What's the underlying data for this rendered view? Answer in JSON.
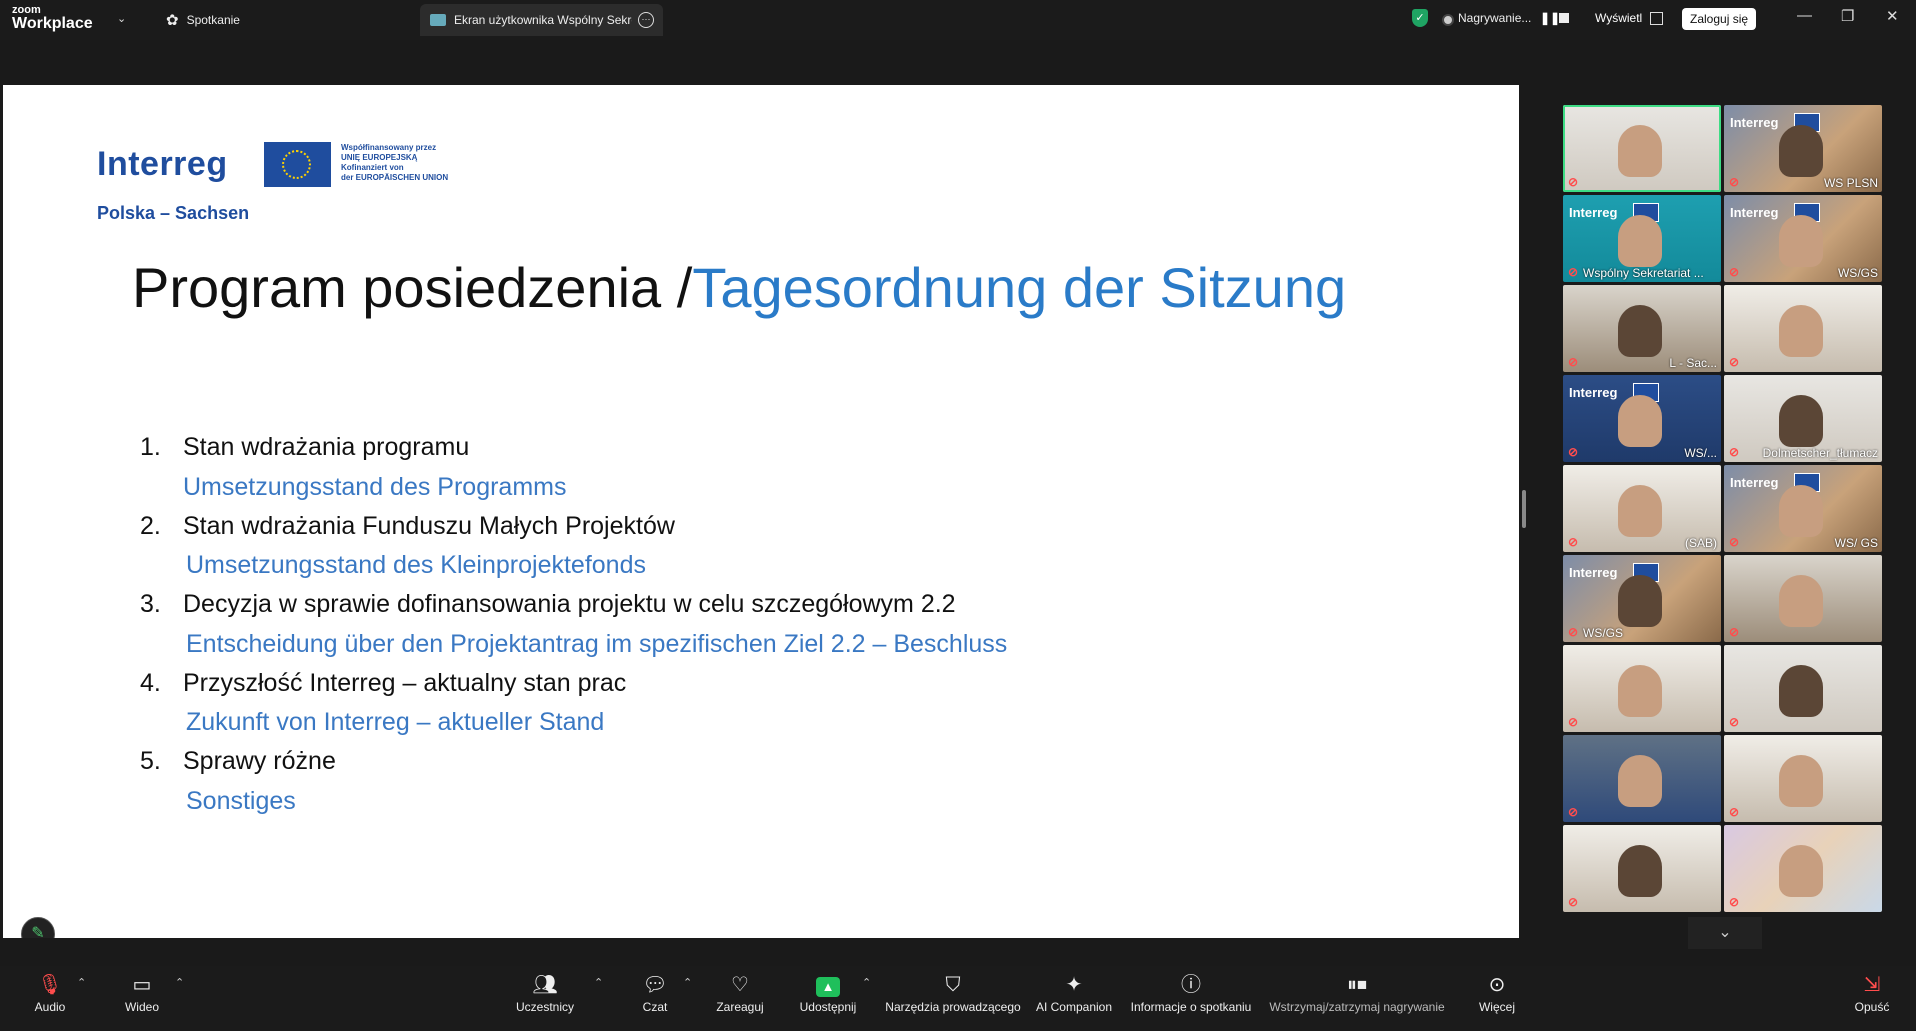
{
  "topbar": {
    "brand_line1": "zoom",
    "brand_line2": "Workplace",
    "meeting_tab": "Spotkanie",
    "share_tab": "Ekran użytkownika Wspólny Sekretariat",
    "recording_label": "Nagrywanie...",
    "view_label": "Wyświetl",
    "login_button": "Zaloguj się"
  },
  "slide": {
    "logo_word": "Interreg",
    "eu_text": [
      "Współfinansowany przez",
      "UNIĘ EUROPEJSKĄ",
      "Kofinanziert von",
      "der EUROPÄISCHEN UNION"
    ],
    "logo_sub": "Polska – Sachsen",
    "title_pl": "Program posiedzenia /",
    "title_de": "Tagesordnung der Sitzung",
    "agenda": [
      {
        "num": "1.",
        "pl": "Stan wdrażania programu",
        "de": "Umsetzungsstand des Programms"
      },
      {
        "num": "2.",
        "pl": "Stan wdrażania Funduszu Małych Projektów",
        "de": "Umsetzungsstand des Kleinprojektefonds"
      },
      {
        "num": "3.",
        "pl": "Decyzja w sprawie dofinansowania projektu w celu szczegółowym 2.2",
        "de": "Entscheidung über den Projektantrag im spezifischen Ziel 2.2 – Beschluss"
      },
      {
        "num": "4.",
        "pl": "Przyszłość Interreg – aktualny stan prac",
        "de": "Zukunft von Interreg – aktueller Stand"
      },
      {
        "num": "5.",
        "pl": "Sprawy różne",
        "de": "Sonstiges"
      }
    ]
  },
  "gallery": {
    "tiles": [
      {
        "name": "",
        "style": "person",
        "active": true
      },
      {
        "name": "WS PLSN",
        "style": "interreg-city"
      },
      {
        "name": "Wspólny Sekretariat ...",
        "style": "interreg-teal"
      },
      {
        "name": "WS/GS",
        "style": "interreg-city"
      },
      {
        "name": "L - Sac...",
        "style": "office"
      },
      {
        "name": "",
        "style": "room"
      },
      {
        "name": "WS/...",
        "style": "interreg-navy"
      },
      {
        "name": "Dolmetscher_tłumacz",
        "style": "person"
      },
      {
        "name": "(SAB)",
        "style": "room"
      },
      {
        "name": "WS/ GS",
        "style": "interreg-city"
      },
      {
        "name": "WS/GS",
        "style": "interreg-city"
      },
      {
        "name": "",
        "style": "office"
      },
      {
        "name": "",
        "style": "room"
      },
      {
        "name": "",
        "style": "person"
      },
      {
        "name": "",
        "style": "eu-flags"
      },
      {
        "name": "",
        "style": "room"
      },
      {
        "name": "",
        "style": "room"
      },
      {
        "name": "",
        "style": "map"
      }
    ]
  },
  "toolbar": {
    "audio": "Audio",
    "video": "Wideo",
    "participants": "Uczestnicy",
    "chat": "Czat",
    "react": "Zareaguj",
    "share": "Udostępnij",
    "host_tools": "Narzędzia prowadzącego",
    "ai_companion": "AI Companion",
    "meeting_info": "Informacje o spotkaniu",
    "recording_control": "Wstrzymaj/zatrzymaj nagrywanie",
    "more": "Więcej",
    "leave": "Opuść"
  },
  "colors": {
    "accent_green": "#1fbf5b",
    "interreg_blue": "#1f4d9e",
    "title_blue": "#2a7bc8",
    "agenda_blue": "#3a78c3",
    "mute_red": "#ff4d4d"
  }
}
